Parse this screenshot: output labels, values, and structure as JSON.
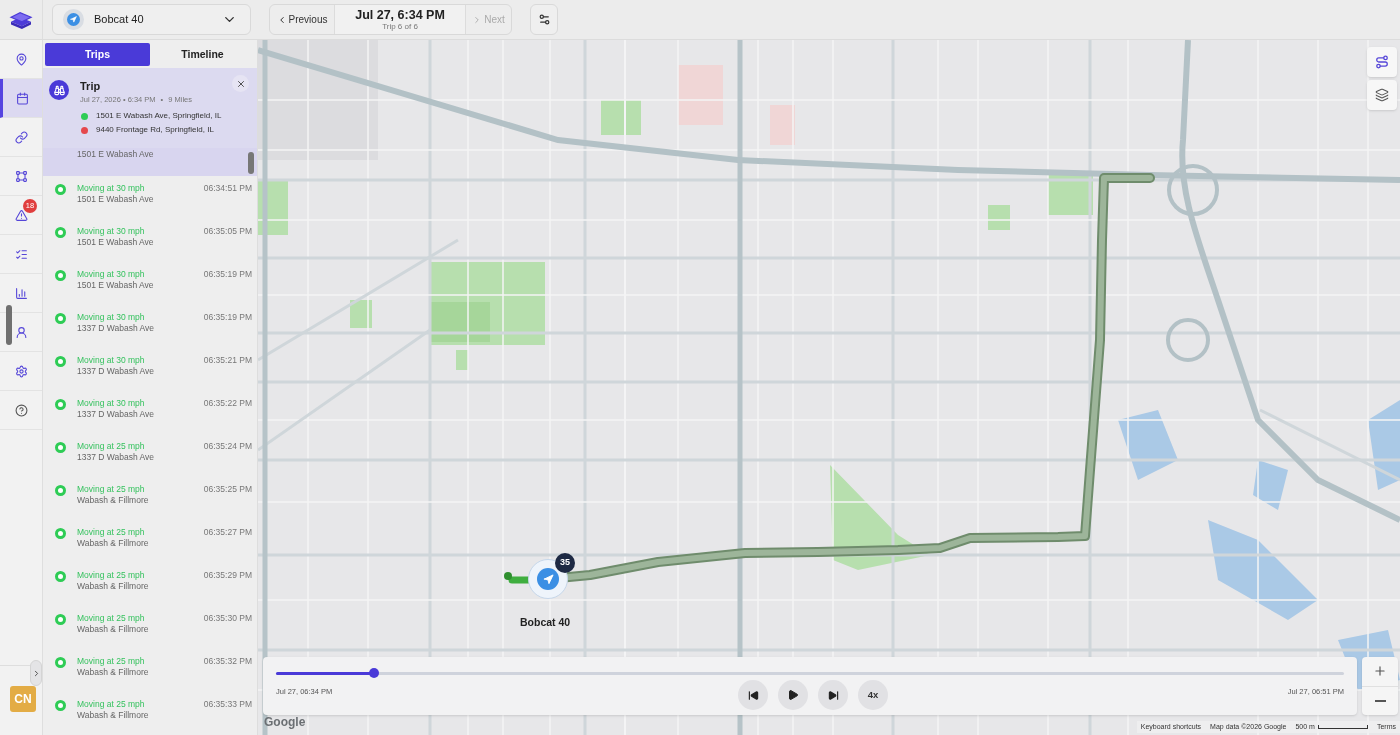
{
  "top_bar": {
    "vehicle_selector": {
      "name": "Bobcat 40"
    },
    "trip_nav": {
      "previous": {
        "label": "Previous",
        "disabled": false
      },
      "date": "Jul 27, 6:34 PM",
      "trip_count": "Trip 6 of 6",
      "next": {
        "label": "Next",
        "disabled": true
      }
    }
  },
  "nav_rail": {
    "items": [
      {
        "selected": false
      },
      {
        "selected": true
      },
      {
        "selected": false
      },
      {
        "selected": false
      },
      {
        "selected": false,
        "badge": "18"
      },
      {
        "selected": false
      },
      {
        "selected": false
      },
      {
        "selected": false
      },
      {
        "selected": false
      },
      {
        "selected": false
      }
    ],
    "avatar": "CN"
  },
  "panel": {
    "tabs": [
      {
        "label": "Trips",
        "selected": true
      },
      {
        "label": "Timeline",
        "selected": false
      }
    ],
    "trip": {
      "title": "Trip",
      "date": "Jul 27, 2026 • 6:34 PM",
      "separator": "•",
      "distance": "9 Miles",
      "stops": [
        {
          "address": "1501 E Wabash Ave, Springfield, IL",
          "color": "#2ecc55"
        },
        {
          "address": "9440 Frontage Rd, Springfield, IL",
          "color": "#e5484d"
        }
      ]
    },
    "events": [
      {
        "address": "1501 E Wabash Ave",
        "selected": true
      },
      {
        "status": "Moving at 30 mph",
        "address": "1501 E Wabash Ave",
        "time": "06:34:51 PM",
        "selected": false
      },
      {
        "status": "Moving at 30 mph",
        "address": "1501 E Wabash Ave",
        "time": "06:35:05 PM",
        "selected": false
      },
      {
        "status": "Moving at 30 mph",
        "address": "1501 E Wabash Ave",
        "time": "06:35:19 PM",
        "selected": false
      },
      {
        "status": "Moving at 30 mph",
        "address": "1337 D Wabash Ave",
        "time": "06:35:19 PM",
        "selected": false
      },
      {
        "status": "Moving at 30 mph",
        "address": "1337 D Wabash Ave",
        "time": "06:35:21 PM",
        "selected": false
      },
      {
        "status": "Moving at 30 mph",
        "address": "1337 D Wabash Ave",
        "time": "06:35:22 PM",
        "selected": false
      },
      {
        "status": "Moving at 25 mph",
        "address": "1337 D Wabash Ave",
        "time": "06:35:24 PM",
        "selected": false
      },
      {
        "status": "Moving at 25 mph",
        "address": "Wabash & Fillmore",
        "time": "06:35:25 PM",
        "selected": false
      },
      {
        "status": "Moving at 25 mph",
        "address": "Wabash & Fillmore",
        "time": "06:35:27 PM",
        "selected": false
      },
      {
        "status": "Moving at 25 mph",
        "address": "Wabash & Fillmore",
        "time": "06:35:29 PM",
        "selected": false
      },
      {
        "status": "Moving at 25 mph",
        "address": "Wabash & Fillmore",
        "time": "06:35:30 PM",
        "selected": false
      },
      {
        "status": "Moving at 25 mph",
        "address": "Wabash & Fillmore",
        "time": "06:35:32 PM",
        "selected": false
      },
      {
        "status": "Moving at 25 mph",
        "address": "Wabash & Fillmore",
        "time": "06:35:33 PM",
        "selected": false
      }
    ]
  },
  "map": {
    "vehicle_marker": {
      "badge": "35",
      "label": "Bobcat 40"
    },
    "playback": {
      "level": 0.092,
      "start": "Jul 27, 06:34 PM",
      "end": "Jul 27, 06:51 PM",
      "speed": "4x"
    },
    "logo": "Google",
    "attribution": {
      "shortcuts": "Keyboard shortcuts",
      "map_data": "Map data ©2026 Google",
      "scale": "500 m",
      "terms": "Terms"
    }
  }
}
